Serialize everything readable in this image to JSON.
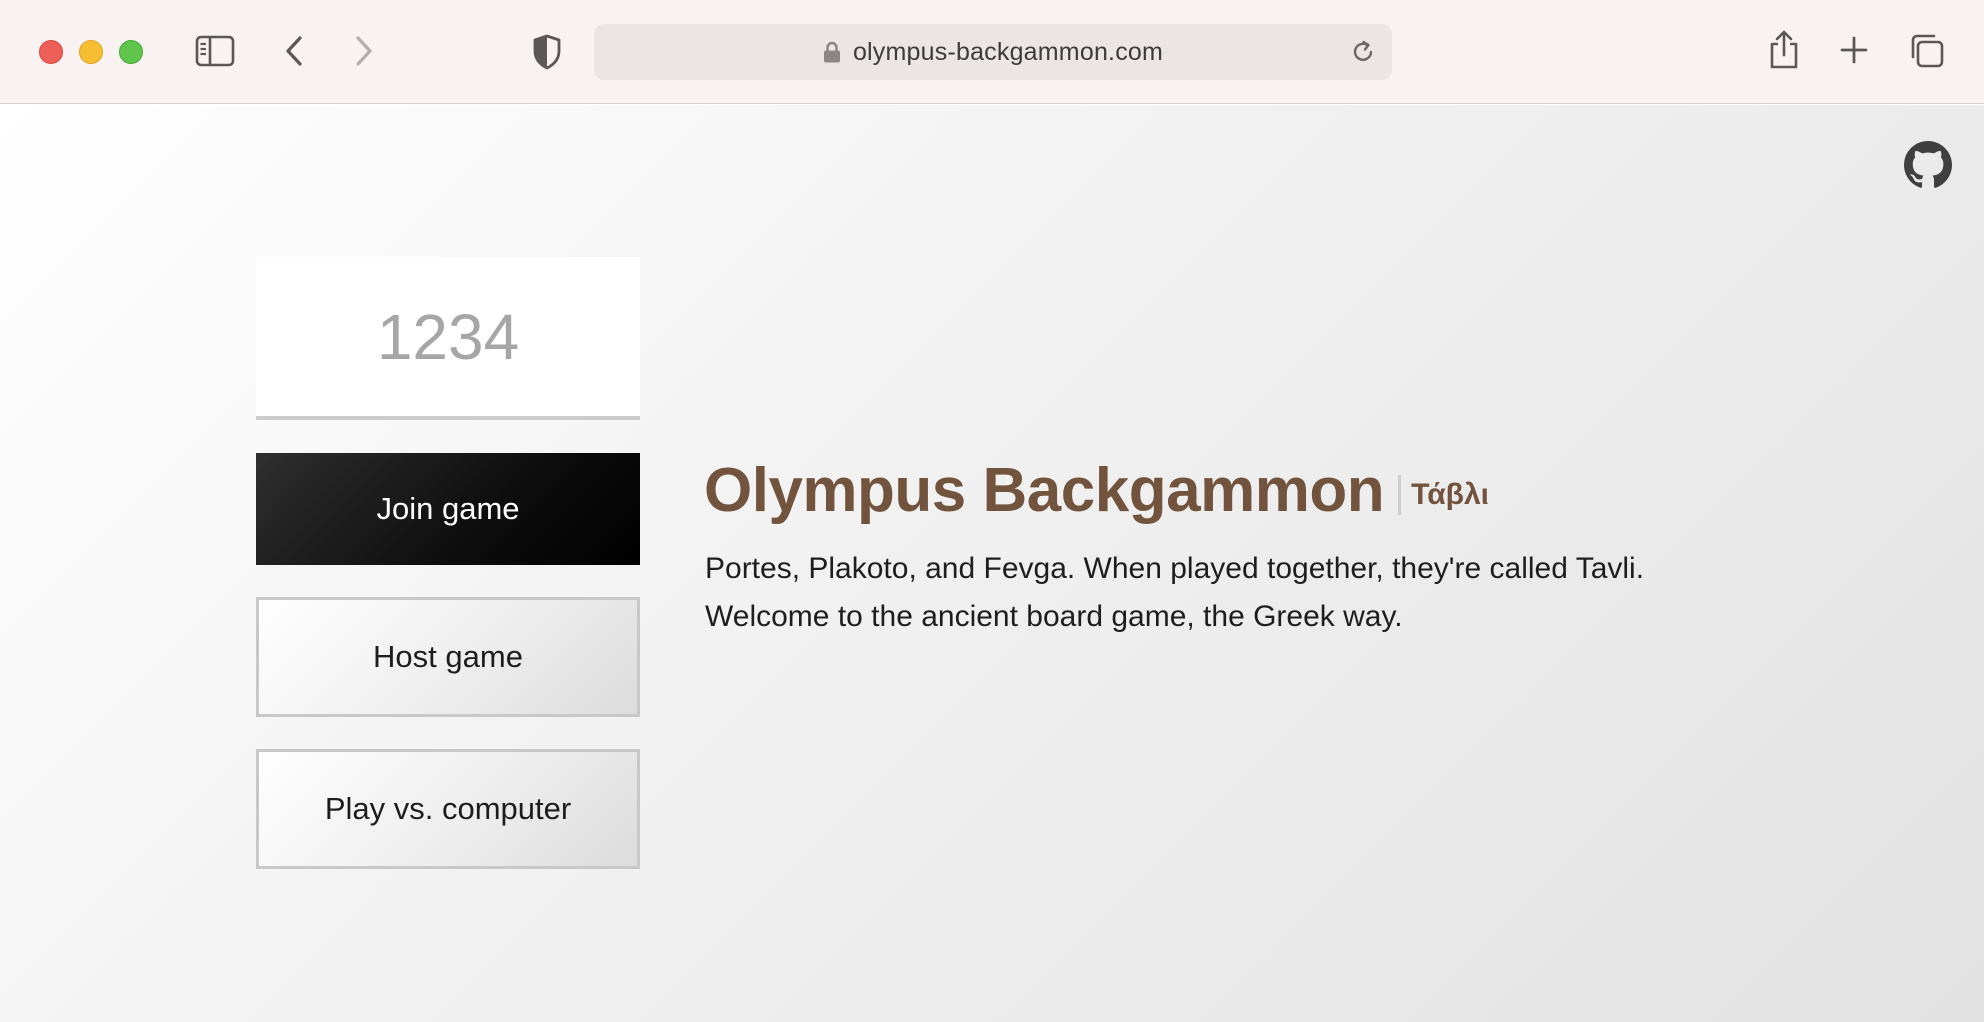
{
  "browser": {
    "url": "olympus-backgammon.com",
    "icons": {
      "sidebar": "sidebar-icon",
      "back": "chevron-left-icon",
      "forward": "chevron-right-icon",
      "privacy": "shield-icon",
      "lock": "lock-icon",
      "reload": "reload-icon",
      "share": "share-icon",
      "new_tab": "plus-icon",
      "tabs": "tab-overview-icon"
    },
    "traffic_colors": {
      "close": "#ee5f58",
      "minimize": "#f8be32",
      "zoom": "#5fc54d"
    }
  },
  "page": {
    "github_icon": "github-icon",
    "game_code_input": {
      "placeholder": "1234",
      "value": ""
    },
    "buttons": {
      "join": "Join game",
      "host": "Host game",
      "computer": "Play vs. computer"
    },
    "title": "Olympus Backgammon",
    "subtitle": "Τάβλι",
    "description_lines": [
      "Portes, Plakoto, and Fevga. When played together, they're called Tavli.",
      "Welcome to the ancient board game, the Greek way."
    ],
    "colors": {
      "title": "#72543e",
      "join_button": "#000000",
      "text": "#1e1e1e"
    }
  }
}
